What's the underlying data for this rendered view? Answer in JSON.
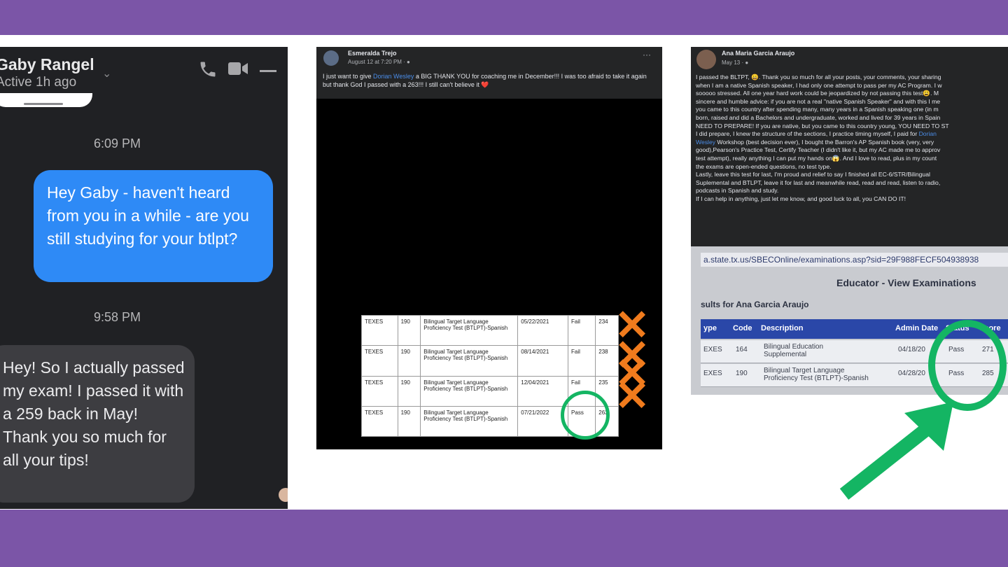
{
  "messenger": {
    "contact_name": "Gaby Rangel",
    "status": "Active 1h ago",
    "timestamp_1": "6:09 PM",
    "outgoing_message": "Hey Gaby - haven't heard from you in a while - are you still studying for your btlpt?",
    "timestamp_2": "9:58 PM",
    "incoming_message": "Hey! So I actually passed my exam! I passed it with a 259 back in May! Thank you so much for all your tips!",
    "icons": [
      "chevron-down-icon",
      "phone-icon",
      "video-camera-icon",
      "minimize-icon"
    ]
  },
  "post1": {
    "author": "Esmeralda Trejo",
    "date": "August 12 at 7:20 PM · ",
    "more": "···",
    "text_before": "I just want to give ",
    "tag": "Dorian Wesley",
    "text_after": " a BIG THANK YOU for coaching me in December!!! I was too afraid to take it again but thank God I passed with a 263!!! I still can't believe it ❤️",
    "table": {
      "rows": [
        [
          "TEXES",
          "190",
          "Bilingual Target Language Proficiency Test (BTLPT)-Spanish",
          "05/22/2021",
          "Fail",
          "234"
        ],
        [
          "TEXES",
          "190",
          "Bilingual Target Language Proficiency Test (BTLPT)-Spanish",
          "08/14/2021",
          "Fail",
          "238"
        ],
        [
          "TEXES",
          "190",
          "Bilingual Target Language Proficiency Test (BTLPT)-Spanish",
          "12/04/2021",
          "Fail",
          "235"
        ],
        [
          "TEXES",
          "190",
          "Bilingual Target Language Proficiency Test (BTLPT)-Spanish",
          "07/21/2022",
          "Pass",
          "263"
        ]
      ]
    },
    "x_mark": "✕",
    "colors": {
      "x_marks": "#f07b1d",
      "circle": "#14b563"
    }
  },
  "post2": {
    "author": "Ana Maria Garcia Araujo",
    "date": "May 13 · ",
    "lines": [
      "I passed the BLTPT, 😀. Thank you so much for all your posts, your comments, your sharing",
      "when I am a native Spanish speaker, I had only one attempt to pass per my AC Program. I w",
      "sooooo stressed. All one year hard work could be jeopardized by not passing this test😩. M",
      "sincere and humble advice: if you are not a real \"native Spanish Speaker\" and with this I me",
      "you came to this country after spending many, many years in a Spanish speaking one (in m",
      "born, raised and did a Bachelors and undergraduate, worked and lived for 39 years in Spain",
      "NEED TO PREPARE! If you are native, but you came to this country young, YOU NEED TO ST",
      "I did prepare, I knew the structure of the sections, I practice timing myself, I paid for "
    ],
    "tag_1": "Dorian",
    "tag_2": "Wesley",
    "lines_after": [
      " Workshop (best decision ever), I bought the Barron's  AP Spanish book (very, very",
      "good),Pearson's Practice Test, Certify Teacher (I didn't like it, but my AC made me to approv",
      "test attempt), really anything I can put my hands on😱. And I love to read, plus in my count",
      "the exams are open-ended questions, no test type.",
      "Lastly, leave this test for last, I'm proud and relief to say I finished all EC-6/STR/Bilingual",
      "Suplemental and BTLPT, leave it for last and meanwhile read, read and read, listen to radio,",
      "podcasts in Spanish and study.",
      "If I can help in anything, just let me know, and good luck to all, you CAN DO IT!"
    ],
    "photo": {
      "url": "a.state.tx.us/SBECOnline/examinations.asp?sid=29F988FECF504938938",
      "title": "Educator - View Examinations",
      "results_for": "sults for Ana Garcia Araujo",
      "headers": [
        "ype",
        "Code",
        "Description",
        "Admin Date",
        "Status",
        "Score"
      ],
      "rows": [
        [
          "EXES",
          "164",
          "Bilingual Education Supplemental",
          "04/18/20",
          "Pass",
          "271"
        ],
        [
          "EXES",
          "190",
          "Bilingual Target Language Proficiency Test (BTLPT)-Spanish",
          "04/28/20",
          "Pass",
          "285"
        ]
      ]
    },
    "colors": {
      "circle": "#14b563",
      "arrow": "#14b563"
    }
  }
}
